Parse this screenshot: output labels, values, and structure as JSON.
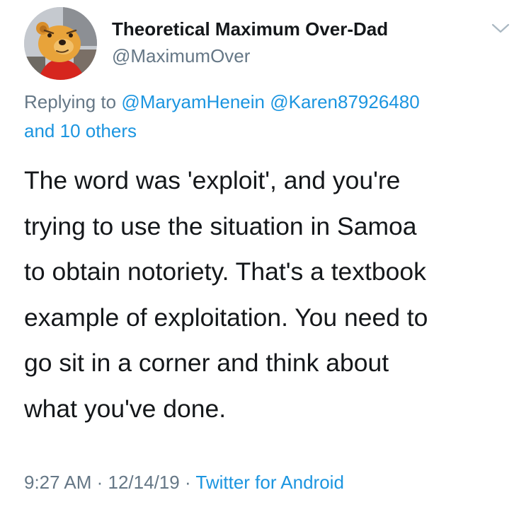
{
  "author": {
    "display_name": "Theoretical Maximum Over-Dad",
    "handle": "@MaximumOver"
  },
  "reply": {
    "prefix": "Replying to",
    "mention_1": "@MaryamHenein",
    "mention_2": "@Karen87926480",
    "others": "and 10 others"
  },
  "tweet": {
    "lines": [
      "The word was 'exploit', and you're",
      "trying to use the situation in Samoa",
      "to obtain notoriety. That's a textbook",
      "example of exploitation. You need to",
      "go sit in a corner and think about",
      "what you've done."
    ]
  },
  "footer": {
    "time": "9:27 AM",
    "sep_1": " · ",
    "date": "12/14/19",
    "sep_2": " · ",
    "source": "Twitter for Android"
  },
  "icons": {
    "avatar": "cartoon-bear-avatar",
    "menu": "chevron-down-icon"
  },
  "colors": {
    "text": "#14171a",
    "secondary": "#657786",
    "link": "#1b95e0"
  }
}
